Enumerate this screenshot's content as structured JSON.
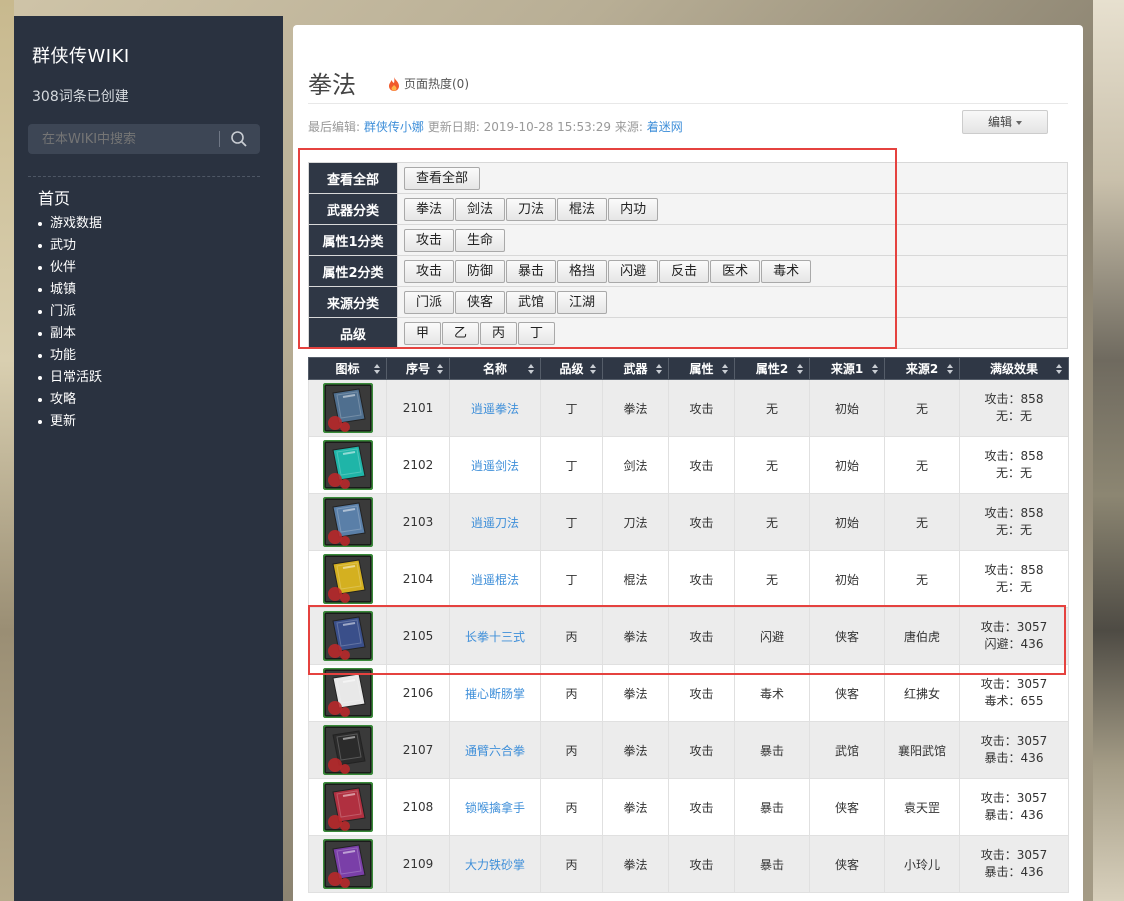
{
  "sidebar": {
    "title": "群侠传WIKI",
    "count": "308词条已创建",
    "search_placeholder": "在本WIKI中搜索",
    "home": "首页",
    "items": [
      "游戏数据",
      "武功",
      "伙伴",
      "城镇",
      "门派",
      "副本",
      "功能",
      "日常活跃",
      "攻略",
      "更新"
    ]
  },
  "page": {
    "title": "拳法",
    "heat": "页面热度(0)",
    "meta": {
      "last_edit_label": "最后编辑:",
      "last_edit_user": "群侠传小娜",
      "update_label": "更新日期:",
      "update_date": "2019-10-28 15:53:29",
      "source_label": "来源:",
      "source_link": "着迷网"
    },
    "edit_label": "编辑"
  },
  "filters": [
    {
      "label": "查看全部",
      "buttons": [
        "查看全部"
      ]
    },
    {
      "label": "武器分类",
      "buttons": [
        "拳法",
        "剑法",
        "刀法",
        "棍法",
        "内功"
      ]
    },
    {
      "label": "属性1分类",
      "buttons": [
        "攻击",
        "生命"
      ]
    },
    {
      "label": "属性2分类",
      "buttons": [
        "攻击",
        "防御",
        "暴击",
        "格挡",
        "闪避",
        "反击",
        "医术",
        "毒术"
      ]
    },
    {
      "label": "来源分类",
      "buttons": [
        "门派",
        "侠客",
        "武馆",
        "江湖"
      ]
    },
    {
      "label": "品级",
      "buttons": [
        "甲",
        "乙",
        "丙",
        "丁"
      ]
    }
  ],
  "table": {
    "headers": [
      "图标",
      "序号",
      "名称",
      "品级",
      "武器",
      "属性",
      "属性2",
      "来源1",
      "来源2",
      "满级效果"
    ],
    "rows": [
      {
        "id": "2101",
        "name": "逍遥拳法",
        "grade": "丁",
        "weapon": "拳法",
        "attr": "攻击",
        "attr2": "无",
        "src1": "初始",
        "src2": "无",
        "eff1": "攻击：858",
        "eff2": "无：无",
        "color": "#4f6f8f"
      },
      {
        "id": "2102",
        "name": "逍遥剑法",
        "grade": "丁",
        "weapon": "剑法",
        "attr": "攻击",
        "attr2": "无",
        "src1": "初始",
        "src2": "无",
        "eff1": "攻击：858",
        "eff2": "无：无",
        "color": "#1fb5a8"
      },
      {
        "id": "2103",
        "name": "逍遥刀法",
        "grade": "丁",
        "weapon": "刀法",
        "attr": "攻击",
        "attr2": "无",
        "src1": "初始",
        "src2": "无",
        "eff1": "攻击：858",
        "eff2": "无：无",
        "color": "#5a7fa8"
      },
      {
        "id": "2104",
        "name": "逍遥棍法",
        "grade": "丁",
        "weapon": "棍法",
        "attr": "攻击",
        "attr2": "无",
        "src1": "初始",
        "src2": "无",
        "eff1": "攻击：858",
        "eff2": "无：无",
        "color": "#d4b020"
      },
      {
        "id": "2105",
        "name": "长拳十三式",
        "grade": "丙",
        "weapon": "拳法",
        "attr": "攻击",
        "attr2": "闪避",
        "src1": "侠客",
        "src2": "唐伯虎",
        "eff1": "攻击：3057",
        "eff2": "闪避：436",
        "color": "#3a4f8a"
      },
      {
        "id": "2106",
        "name": "摧心断肠掌",
        "grade": "丙",
        "weapon": "拳法",
        "attr": "攻击",
        "attr2": "毒术",
        "src1": "侠客",
        "src2": "红拂女",
        "eff1": "攻击：3057",
        "eff2": "毒术：655",
        "color": "#e8e8e8"
      },
      {
        "id": "2107",
        "name": "通臂六合拳",
        "grade": "丙",
        "weapon": "拳法",
        "attr": "攻击",
        "attr2": "暴击",
        "src1": "武馆",
        "src2": "襄阳武馆",
        "eff1": "攻击：3057",
        "eff2": "暴击：436",
        "color": "#2b2b2b"
      },
      {
        "id": "2108",
        "name": "锁喉擒拿手",
        "grade": "丙",
        "weapon": "拳法",
        "attr": "攻击",
        "attr2": "暴击",
        "src1": "侠客",
        "src2": "袁天罡",
        "eff1": "攻击：3057",
        "eff2": "暴击：436",
        "color": "#b03040"
      },
      {
        "id": "2109",
        "name": "大力铁砂掌",
        "grade": "丙",
        "weapon": "拳法",
        "attr": "攻击",
        "attr2": "暴击",
        "src1": "侠客",
        "src2": "小玲儿",
        "eff1": "攻击：3057",
        "eff2": "暴击：436",
        "color": "#7a3fa8"
      }
    ]
  }
}
